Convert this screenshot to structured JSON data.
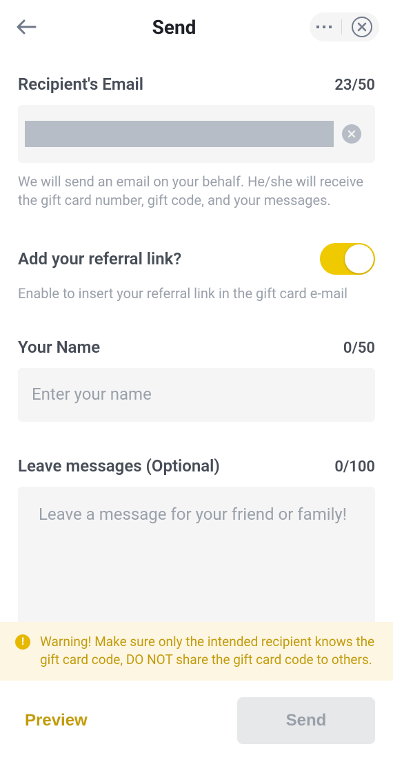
{
  "header": {
    "title": "Send"
  },
  "email": {
    "label": "Recipient's Email",
    "counter": "23/50",
    "helper": "We will send an email on your behalf. He/she will receive the gift card number, gift code, and your messages."
  },
  "referral": {
    "label": "Add your referral link?",
    "helper": "Enable to insert your referral link in the gift card e-mail",
    "enabled": true
  },
  "name": {
    "label": "Your Name",
    "counter": "0/50",
    "placeholder": "Enter your name",
    "value": ""
  },
  "message": {
    "label": "Leave messages (Optional)",
    "counter": "0/100",
    "placeholder": "Leave a message for your friend or family!",
    "value": ""
  },
  "warning": {
    "text": "Warning! Make sure only the intended recipient knows the gift card code, DO NOT share the gift card code to others."
  },
  "footer": {
    "preview": "Preview",
    "send": "Send"
  }
}
